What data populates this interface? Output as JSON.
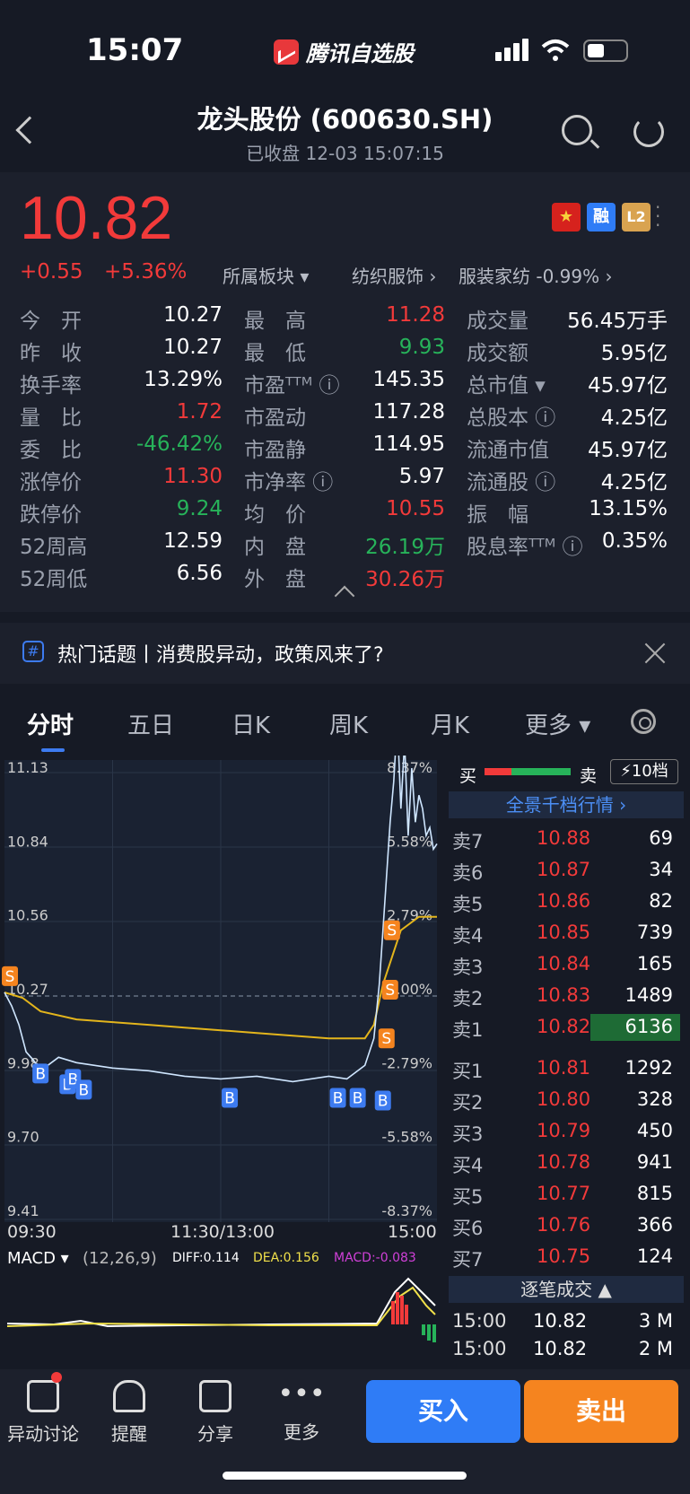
{
  "status": {
    "time": "15:07",
    "app": "腾讯自选股"
  },
  "header": {
    "title": "龙头股份 (600630.SH)",
    "subtitle": "已收盘   12-03 15:07:15"
  },
  "quote": {
    "price": "10.82",
    "change": "+0.55",
    "change_pct": "+5.36%",
    "sector_label": "所属板块 ▾",
    "sector1": "纺织服饰 ›",
    "sector2": "服装家纺 -0.99% ›",
    "badges": [
      "融",
      "L2"
    ],
    "col1": [
      {
        "k": "今　开",
        "v": "10.27",
        "c": "w"
      },
      {
        "k": "昨　收",
        "v": "10.27",
        "c": "w"
      },
      {
        "k": "换手率",
        "v": "13.29%",
        "c": "w"
      },
      {
        "k": "量　比",
        "v": "1.72",
        "c": "r"
      },
      {
        "k": "委　比",
        "v": "-46.42%",
        "c": "g"
      },
      {
        "k": "涨停价",
        "v": "11.30",
        "c": "r"
      },
      {
        "k": "跌停价",
        "v": "9.24",
        "c": "g"
      },
      {
        "k": "52周高",
        "v": "12.59",
        "c": "w"
      },
      {
        "k": "52周低",
        "v": "6.56",
        "c": "w"
      }
    ],
    "col2": [
      {
        "k": "最　高",
        "v": "11.28",
        "c": "r"
      },
      {
        "k": "最　低",
        "v": "9.93",
        "c": "g"
      },
      {
        "k": "市盈ᵀᵀᴹ ⓘ",
        "v": "145.35",
        "c": "w"
      },
      {
        "k": "市盈动",
        "v": "117.28",
        "c": "w"
      },
      {
        "k": "市盈静",
        "v": "114.95",
        "c": "w"
      },
      {
        "k": "市净率 ⓘ",
        "v": "5.97",
        "c": "w"
      },
      {
        "k": "均　价",
        "v": "10.55",
        "c": "r"
      },
      {
        "k": "内　盘",
        "v": "26.19万",
        "c": "g"
      },
      {
        "k": "外　盘",
        "v": "30.26万",
        "c": "r"
      }
    ],
    "col3": [
      {
        "k": "成交量",
        "v": "56.45万手",
        "c": "w"
      },
      {
        "k": "成交额",
        "v": "5.95亿",
        "c": "w"
      },
      {
        "k": "总市值 ▾",
        "v": "45.97亿",
        "c": "w"
      },
      {
        "k": "总股本 ⓘ",
        "v": "4.25亿",
        "c": "w"
      },
      {
        "k": "流通市值",
        "v": "45.97亿",
        "c": "w"
      },
      {
        "k": "流通股 ⓘ",
        "v": "4.25亿",
        "c": "w"
      },
      {
        "k": "振　幅",
        "v": "13.15%",
        "c": "w"
      },
      {
        "k": "股息率ᵀᵀᴹ ⓘ",
        "v": "0.35%",
        "c": "w"
      }
    ]
  },
  "topic": {
    "text": "热门话题丨消费股异动，政策风来了?"
  },
  "tabs": [
    "分时",
    "五日",
    "日K",
    "周K",
    "月K",
    "更多 ▾"
  ],
  "chart": {
    "y_left": [
      "11.13",
      "10.84",
      "10.56",
      "10.27",
      "9.98",
      "9.70",
      "9.41"
    ],
    "y_right": [
      "8.37%",
      "5.58%",
      "2.79%",
      "0.00%",
      "-2.79%",
      "-5.58%",
      "-8.37%"
    ],
    "x_labels": [
      "09:30",
      "11:30/13:00",
      "15:00"
    ],
    "macd_label": "MACD ▾",
    "macd_params": "(12,26,9)",
    "diff": "DIFF:0.114",
    "dea": "DEA:0.156",
    "macd": "MACD:-0.083"
  },
  "chart_data": {
    "type": "line",
    "title": "",
    "ylim": [
      9.41,
      11.13
    ],
    "prev_close": 10.27,
    "series": [
      {
        "name": "price",
        "x": [
          0,
          4,
          8,
          12,
          16,
          20,
          30,
          40,
          50,
          60,
          80,
          100,
          120,
          140,
          160,
          180,
          190,
          200,
          205,
          208,
          210,
          212,
          214,
          216,
          218,
          220,
          222,
          224,
          226,
          228,
          230,
          232,
          234,
          236,
          238,
          240
        ],
        "values": [
          10.27,
          10.22,
          10.15,
          10.05,
          10.02,
          9.98,
          10.03,
          10.01,
          10.0,
          9.99,
          9.98,
          9.96,
          9.95,
          9.96,
          9.94,
          9.96,
          9.95,
          10.0,
          10.1,
          10.3,
          10.5,
          10.7,
          10.9,
          11.05,
          11.28,
          10.95,
          11.2,
          10.85,
          11.1,
          10.9,
          11.0,
          10.95,
          10.85,
          10.88,
          10.8,
          10.82
        ]
      },
      {
        "name": "avg",
        "x": [
          0,
          10,
          20,
          40,
          60,
          80,
          100,
          120,
          140,
          160,
          180,
          200,
          205,
          210,
          220,
          230,
          240
        ],
        "values": [
          10.27,
          10.25,
          10.2,
          10.17,
          10.16,
          10.15,
          10.14,
          10.13,
          10.12,
          10.11,
          10.1,
          10.1,
          10.15,
          10.3,
          10.5,
          10.55,
          10.55
        ]
      }
    ],
    "signals": [
      "S",
      "B",
      "B",
      "B",
      "B",
      "B",
      "B",
      "B",
      "B",
      "S",
      "S",
      "S"
    ]
  },
  "orderbook": {
    "header_buy": "买",
    "header_sell": "卖",
    "levels_btn": "10档",
    "full_depth": "全景千档行情 ›",
    "asks": [
      {
        "k": "卖7",
        "p": "10.88",
        "v": "69"
      },
      {
        "k": "卖6",
        "p": "10.87",
        "v": "34"
      },
      {
        "k": "卖5",
        "p": "10.86",
        "v": "82"
      },
      {
        "k": "卖4",
        "p": "10.85",
        "v": "739"
      },
      {
        "k": "卖3",
        "p": "10.84",
        "v": "165"
      },
      {
        "k": "卖2",
        "p": "10.83",
        "v": "1489"
      },
      {
        "k": "卖1",
        "p": "10.82",
        "v": "6136"
      }
    ],
    "bids": [
      {
        "k": "买1",
        "p": "10.81",
        "v": "1292"
      },
      {
        "k": "买2",
        "p": "10.80",
        "v": "328"
      },
      {
        "k": "买3",
        "p": "10.79",
        "v": "450"
      },
      {
        "k": "买4",
        "p": "10.78",
        "v": "941"
      },
      {
        "k": "买5",
        "p": "10.77",
        "v": "815"
      },
      {
        "k": "买6",
        "p": "10.76",
        "v": "366"
      },
      {
        "k": "买7",
        "p": "10.75",
        "v": "124"
      }
    ],
    "ticks_title": "逐笔成交 ▲",
    "ticks": [
      {
        "t": "15:00",
        "p": "10.82",
        "v": "3 M"
      },
      {
        "t": "15:00",
        "p": "10.82",
        "v": "2 M"
      }
    ]
  },
  "bottom": {
    "items": [
      "异动讨论",
      "提醒",
      "分享",
      "更多"
    ],
    "buy": "买入",
    "sell": "卖出"
  }
}
